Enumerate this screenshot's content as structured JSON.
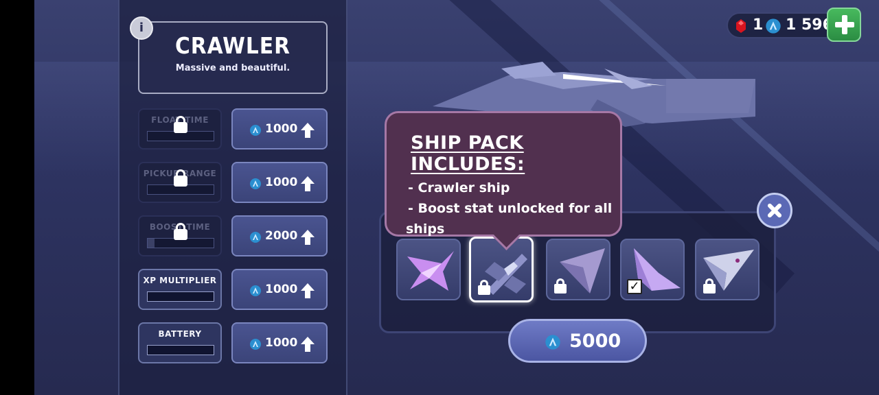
{
  "currency": {
    "gems": "1",
    "coins": "1 596"
  },
  "ship": {
    "name": "CRAWLER",
    "description": "Massive and beautiful."
  },
  "info_label": "i",
  "stats": [
    {
      "label": "FLOAT TIME",
      "locked": true,
      "level": 0,
      "cost": "1000"
    },
    {
      "label": "PICKUP RANGE",
      "locked": true,
      "level": 0,
      "cost": "1000"
    },
    {
      "label": "BOOST TIME",
      "locked": true,
      "level": 0.1,
      "cost": "2000"
    },
    {
      "label": "XP MULTIPLIER",
      "locked": false,
      "level": 0,
      "cost": "1000"
    },
    {
      "label": "BATTERY",
      "locked": false,
      "level": 0,
      "cost": "1000"
    }
  ],
  "tooltip": {
    "title": "SHIP PACK INCLUDES:",
    "line1": "- Crawler ship",
    "line2": "- Boost stat unlocked for all",
    "line3": "ships"
  },
  "ships": [
    {
      "icon": "manta-ship-icon",
      "status": "owned",
      "color": "#c98ef0"
    },
    {
      "icon": "crawler-ship-icon",
      "status": "locked",
      "selected": true,
      "color": "#8e92c8"
    },
    {
      "icon": "glider-ship-icon",
      "status": "locked",
      "color": "#a59ad0"
    },
    {
      "icon": "delta-ship-icon",
      "status": "equipped",
      "color": "#c6a9f2"
    },
    {
      "icon": "jet-ship-icon",
      "status": "locked",
      "color": "#cfd2ea"
    }
  ],
  "buy": {
    "price": "5000"
  },
  "colors": {
    "accent": "#4b56a2",
    "tooltip_bg": "#51304f",
    "plus_green": "#3aa552"
  }
}
